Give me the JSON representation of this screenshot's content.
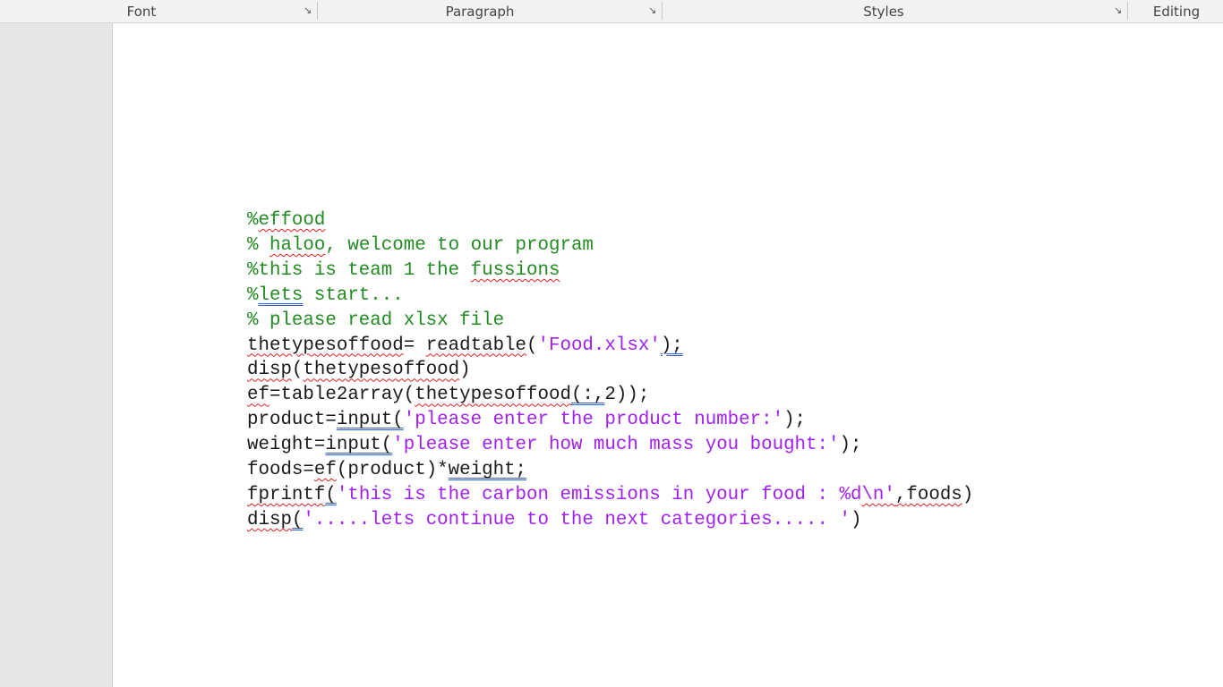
{
  "ribbon": {
    "groups": [
      {
        "label": "Font",
        "launcher": true
      },
      {
        "label": "Paragraph",
        "launcher": true
      },
      {
        "label": "Styles",
        "launcher": true
      },
      {
        "label": "Editing",
        "launcher": false
      }
    ],
    "launcher_icon": "dialog-launcher-icon"
  },
  "colors": {
    "comment": "#228b22",
    "string": "#a020f0",
    "code": "#1a1a1a",
    "spelling_underline": "#e02020",
    "grammar_underline": "#3060d0"
  },
  "document": {
    "lines": [
      [
        {
          "t": "%",
          "c": "g"
        },
        {
          "t": "effood",
          "c": "g",
          "u": "r"
        }
      ],
      [
        {
          "t": "% ",
          "c": "g"
        },
        {
          "t": "haloo",
          "c": "g",
          "u": "r"
        },
        {
          "t": ", welcome to our program",
          "c": "g"
        }
      ],
      [
        {
          "t": "%this is team 1 the ",
          "c": "g"
        },
        {
          "t": "fussions",
          "c": "g",
          "u": "r"
        }
      ],
      [
        {
          "t": "%",
          "c": "g"
        },
        {
          "t": "lets",
          "c": "g",
          "u": "b"
        },
        {
          "t": " start...",
          "c": "g"
        }
      ],
      [
        {
          "t": "% please read xlsx file",
          "c": "g"
        }
      ],
      [
        {
          "t": "thetypesoffood",
          "c": "k",
          "u": "r"
        },
        {
          "t": "= ",
          "c": "k"
        },
        {
          "t": "readtable",
          "c": "k",
          "u": "r"
        },
        {
          "t": "(",
          "c": "k"
        },
        {
          "t": "'Food.xlsx'",
          "c": "s"
        },
        {
          "t": ");",
          "c": "k",
          "u": "b"
        }
      ],
      [
        {
          "t": "disp",
          "c": "k",
          "u": "r"
        },
        {
          "t": "(",
          "c": "k"
        },
        {
          "t": "thetypesoffood",
          "c": "k",
          "u": "r"
        },
        {
          "t": ")",
          "c": "k"
        }
      ],
      [
        {
          "t": "ef",
          "c": "k",
          "u": "r"
        },
        {
          "t": "=table2array(",
          "c": "k"
        },
        {
          "t": "thetypesoffood",
          "c": "k",
          "u": "r"
        },
        {
          "t": "(:,",
          "c": "k",
          "u": "b"
        },
        {
          "t": "2));",
          "c": "k"
        }
      ],
      [
        {
          "t": "product=",
          "c": "k"
        },
        {
          "t": "input(",
          "c": "k",
          "u": "b"
        },
        {
          "t": "'please enter the product number:'",
          "c": "s"
        },
        {
          "t": ");",
          "c": "k"
        }
      ],
      [
        {
          "t": "weight=",
          "c": "k"
        },
        {
          "t": "input(",
          "c": "k",
          "u": "b"
        },
        {
          "t": "'please enter how much mass you bought:'",
          "c": "s"
        },
        {
          "t": ");",
          "c": "k"
        }
      ],
      [
        {
          "t": "foods=",
          "c": "k"
        },
        {
          "t": "ef",
          "c": "k",
          "u": "r"
        },
        {
          "t": "(product)*",
          "c": "k"
        },
        {
          "t": "weight;",
          "c": "k",
          "u": "b"
        }
      ],
      [
        {
          "t": "fprintf",
          "c": "k",
          "u": "r"
        },
        {
          "t": "(",
          "c": "k",
          "u": "b"
        },
        {
          "t": "'this is the carbon emissions in your food : %d",
          "c": "s"
        },
        {
          "t": "\\n'",
          "c": "s",
          "u": "r"
        },
        {
          "t": ",",
          "c": "k",
          "u": "r"
        },
        {
          "t": "foods",
          "c": "k",
          "u": "r"
        },
        {
          "t": ")",
          "c": "k"
        }
      ],
      [
        {
          "t": "disp",
          "c": "k",
          "u": "r"
        },
        {
          "t": "(",
          "c": "k",
          "u": "b"
        },
        {
          "t": "'.....lets continue to the next categories..... '",
          "c": "s"
        },
        {
          "t": ")",
          "c": "k"
        }
      ]
    ]
  }
}
